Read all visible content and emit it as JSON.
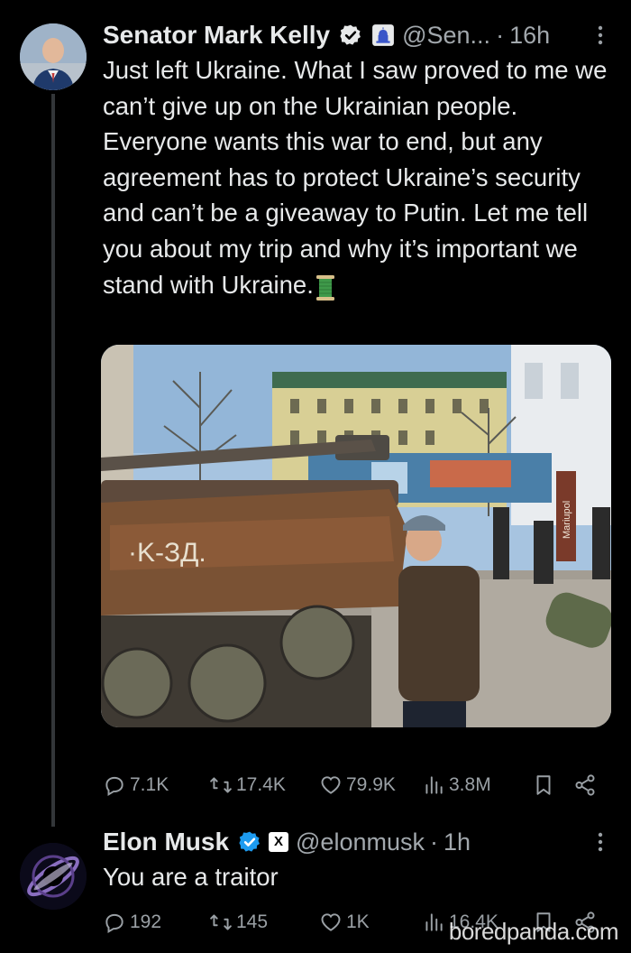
{
  "tweets": [
    {
      "author": "Senator Mark Kelly",
      "handle": "@Sen...",
      "time": "16h",
      "text": "Just left Ukraine. What I saw proved to me we can’t give up on the Ukrainian people. Everyone wants this war to end, but any agreement has to protect Ukraine’s security and can’t be a giveaway to Putin. Let me tell you about my trip and why it’s important we stand with Ukraine.",
      "text_emoji": "spool-of-thread",
      "media_sign": "Mariupol",
      "stats": {
        "replies": "7.1K",
        "reposts": "17.4K",
        "likes": "79.9K",
        "views": "3.8M"
      }
    },
    {
      "author": "Elon Musk",
      "badge": "X",
      "handle": "@elonmusk",
      "time": "1h",
      "text": "You are a traitor",
      "stats": {
        "replies": "192",
        "reposts": "145",
        "likes": "1K",
        "views": "16.4K"
      }
    }
  ],
  "watermark": "boredpanda.com",
  "colors": {
    "background": "#000000",
    "text": "#e7e9ea",
    "muted": "#9aa0a5",
    "verified": "#1d9bf0"
  }
}
